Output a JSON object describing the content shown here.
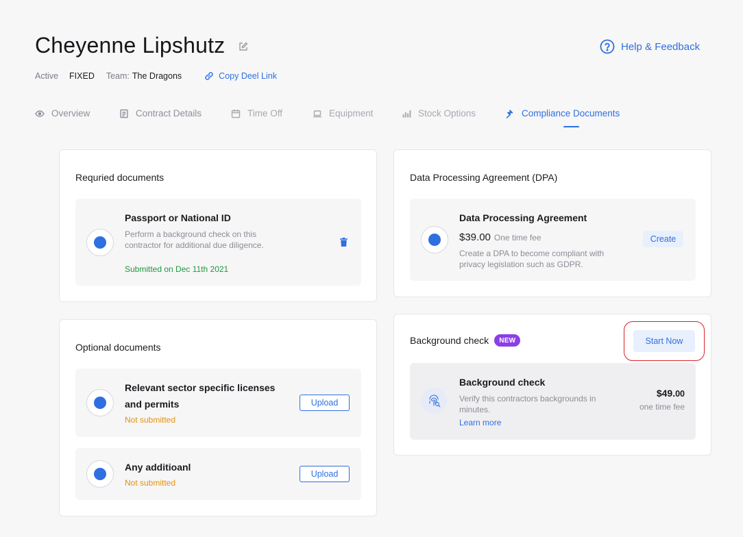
{
  "header": {
    "title": "Cheyenne Lipshutz",
    "help_label": "Help & Feedback",
    "meta": {
      "status": "Active",
      "contract_type": "FIXED",
      "team_prefix": "Team:",
      "team_name": "The Dragons",
      "copy_link_label": "Copy Deel Link"
    }
  },
  "tabs": [
    {
      "label": "Overview",
      "icon": "eye-icon"
    },
    {
      "label": "Contract Details",
      "icon": "document-icon"
    },
    {
      "label": "Time Off",
      "icon": "calendar-icon"
    },
    {
      "label": "Equipment",
      "icon": "laptop-icon"
    },
    {
      "label": "Stock Options",
      "icon": "bar-chart-icon"
    },
    {
      "label": "Compliance Documents",
      "icon": "gavel-icon",
      "active": true
    }
  ],
  "required_documents": {
    "title": "Requried documents",
    "items": [
      {
        "title": "Passport or National ID",
        "description": "Perform a background check on this contractor for additional due diligence.",
        "status": "Submitted on Dec 11th 2021"
      }
    ]
  },
  "optional_documents": {
    "title": "Optional documents",
    "items": [
      {
        "title": "Relevant sector specific licenses and permits",
        "status": "Not submitted",
        "button_label": "Upload"
      },
      {
        "title": "Any additioanl",
        "status": "Not submitted",
        "button_label": "Upload"
      }
    ]
  },
  "dpa": {
    "title": "Data Processing Agreement (DPA)",
    "item": {
      "title": "Data Processing Agreement",
      "price": "$39.00",
      "price_note": "One time fee",
      "description": "Create a DPA to become compliant with privacy legislation such as GDPR.",
      "button_label": "Create"
    }
  },
  "background_check": {
    "title": "Background check",
    "badge": "NEW",
    "button_label": "Start Now",
    "item": {
      "title": "Background check",
      "description": "Verify this contractors backgrounds in minutes.",
      "link_label": "Learn more",
      "price_main": "$49.",
      "price_cents": "00",
      "price_note": "one time fee"
    }
  },
  "colors": {
    "accent": "#2f6fe0",
    "submitted": "#1e9a3b",
    "not_submitted": "#e0930f",
    "badge": "#8b3fe6",
    "highlight": "#dc1f26"
  }
}
